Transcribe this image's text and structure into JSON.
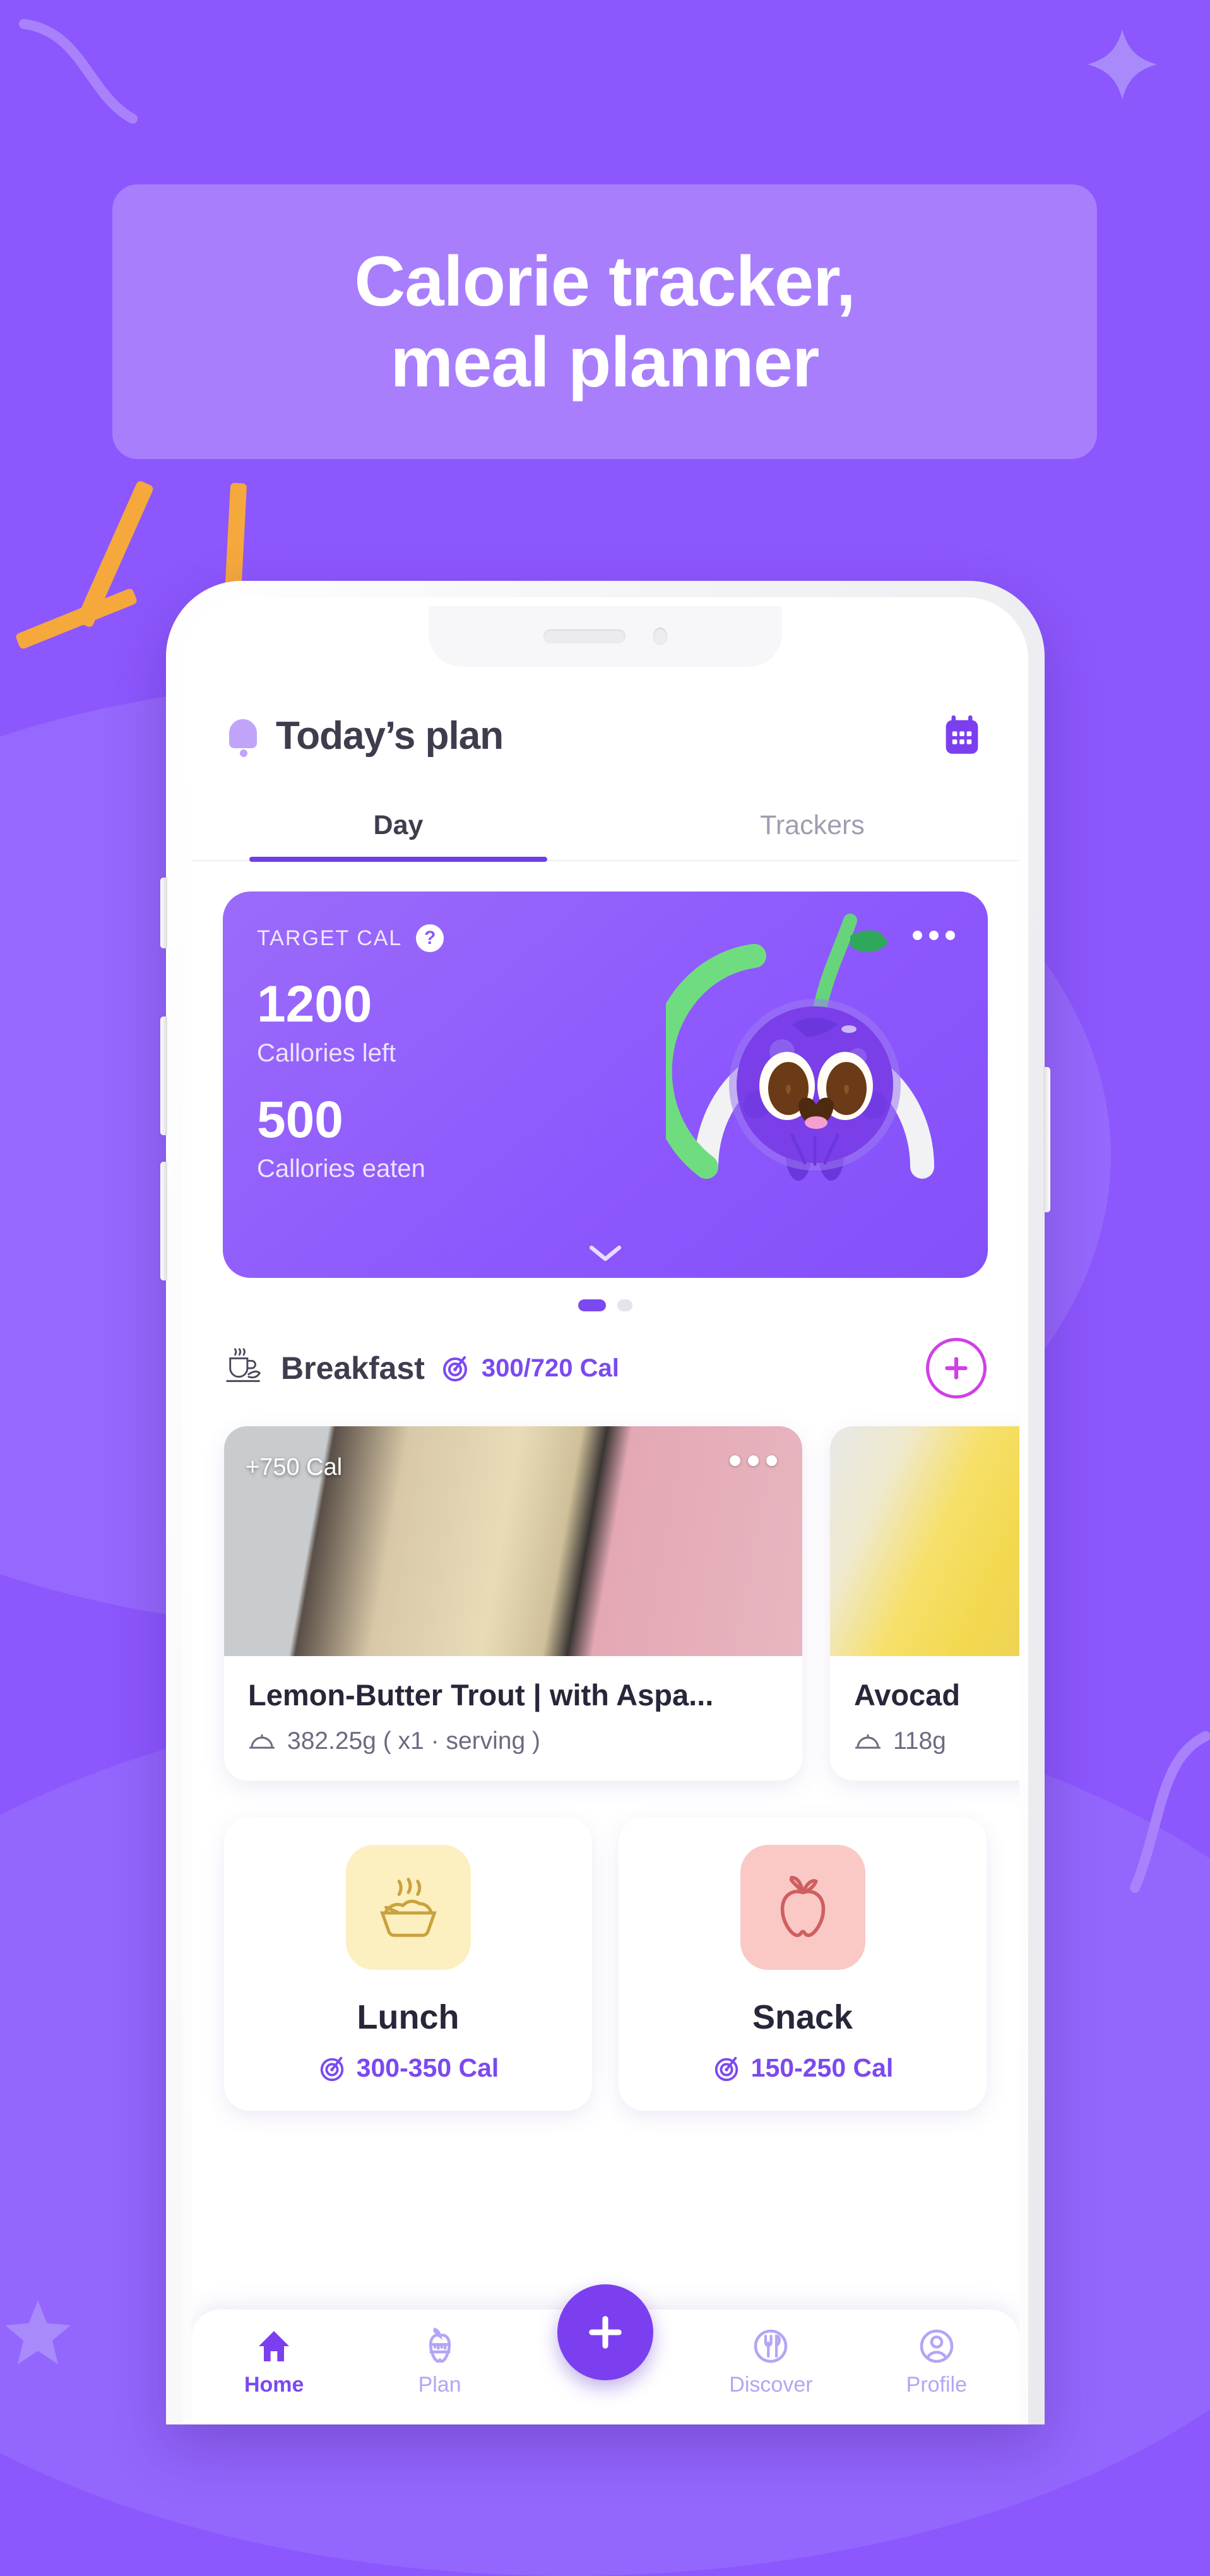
{
  "theme": {
    "bg_purple": "#8C57FD",
    "banner_purple": "#A87EFD",
    "accent_purple": "#7B49F0",
    "accent_magenta": "#D13FE8",
    "ray_orange": "#F5A83C",
    "ring_green": "#6FDD7F",
    "ring_track": "#F2F2F4"
  },
  "banner": {
    "line1": "Calorie tracker,",
    "line2": "meal planner"
  },
  "app": {
    "header": {
      "bell_icon": "bell-icon",
      "title": "Today’s plan",
      "calendar_icon": "calendar-icon"
    },
    "tabs": [
      {
        "label": "Day",
        "active": true
      },
      {
        "label": "Trackers",
        "active": false
      }
    ],
    "calorie_card": {
      "target_label": "TARGET CAL",
      "help_icon": "?",
      "menu_icon": "more-horizontal-icon",
      "left_value": "1200",
      "left_caption": "Callories left",
      "eaten_value": "500",
      "eaten_caption": "Callories eaten",
      "expand_icon": "chevron-down-icon",
      "mascot": "blueberry-mascot",
      "ring_progress_percent": 40
    },
    "pager": {
      "total": 2,
      "active_index": 0
    },
    "meal_header": {
      "icon": "coffee-cup-icon",
      "name": "Breakfast",
      "target_icon": "target-icon",
      "calories": "300/720 Cal",
      "add_button": "+"
    },
    "food_cards": [
      {
        "badge": "+750 Cal",
        "menu_icon": "more-horizontal-icon",
        "title": "Lemon-Butter Trout | with Aspa...",
        "weight_icon": "cloche-icon",
        "weight": "382.25g ( x1 · serving )"
      },
      {
        "title": "Avocad",
        "weight_icon": "cloche-icon",
        "weight": "118g"
      }
    ],
    "meal_tiles": [
      {
        "name": "Lunch",
        "icon": "steaming-bowl-icon",
        "icon_bg": "#FCEFC0",
        "target_icon": "target-icon",
        "calories": "300-350 Cal"
      },
      {
        "name": "Snack",
        "icon": "apple-icon",
        "icon_bg": "#FAC9C5",
        "target_icon": "target-icon",
        "calories": "150-250 Cal"
      }
    ],
    "bottom_nav": {
      "items": [
        {
          "label": "Home",
          "icon": "home-icon",
          "active": true
        },
        {
          "label": "Plan",
          "icon": "apple-measure-icon",
          "active": false
        },
        {
          "label": "Discover",
          "icon": "fork-spoon-icon",
          "active": false
        },
        {
          "label": "Profile",
          "icon": "person-icon",
          "active": false
        }
      ],
      "fab": {
        "label": "+",
        "icon": "plus-icon"
      }
    }
  }
}
